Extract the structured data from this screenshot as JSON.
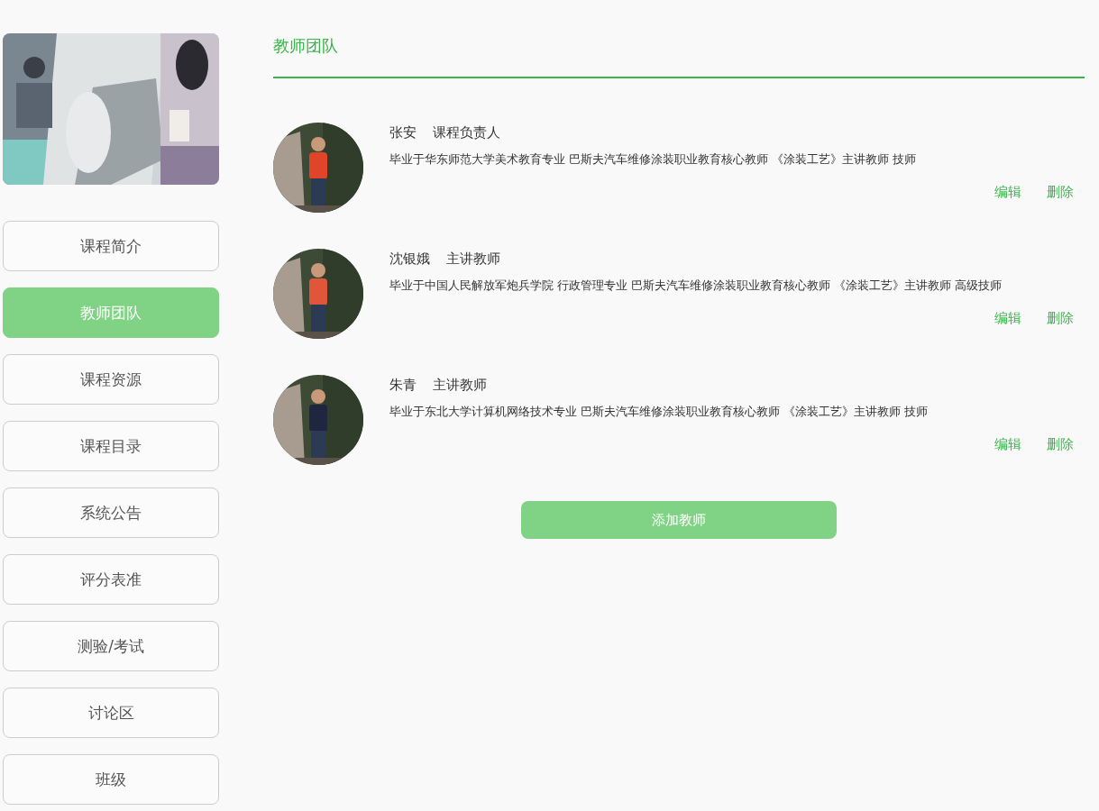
{
  "nav": [
    {
      "label": "课程简介",
      "selected": false
    },
    {
      "label": "教师团队",
      "selected": true
    },
    {
      "label": "课程资源",
      "selected": false
    },
    {
      "label": "课程目录",
      "selected": false
    },
    {
      "label": "系统公告",
      "selected": false
    },
    {
      "label": "评分表准",
      "selected": false
    },
    {
      "label": "测验/考试",
      "selected": false
    },
    {
      "label": "讨论区",
      "selected": false
    },
    {
      "label": "班级",
      "selected": false
    }
  ],
  "section_title": "教师团队",
  "teachers": [
    {
      "name": "张安",
      "role": "课程负责人",
      "bio": "毕业于华东师范大学美术教育专业 巴斯夫汽车维修涂装职业教育核心教师 《涂装工艺》主讲教师 技师",
      "edit": "编辑",
      "delete": "删除"
    },
    {
      "name": "沈银娥",
      "role": "主讲教师",
      "bio": "毕业于中国人民解放军炮兵学院 行政管理专业 巴斯夫汽车维修涂装职业教育核心教师 《涂装工艺》主讲教师 高级技师",
      "edit": "编辑",
      "delete": "删除"
    },
    {
      "name": "朱青",
      "role": "主讲教师",
      "bio": "毕业于东北大学计算机网络技术专业 巴斯夫汽车维修涂装职业教育核心教师 《涂装工艺》主讲教师 技师",
      "edit": "编辑",
      "delete": "删除"
    }
  ],
  "add_button": "添加教师"
}
